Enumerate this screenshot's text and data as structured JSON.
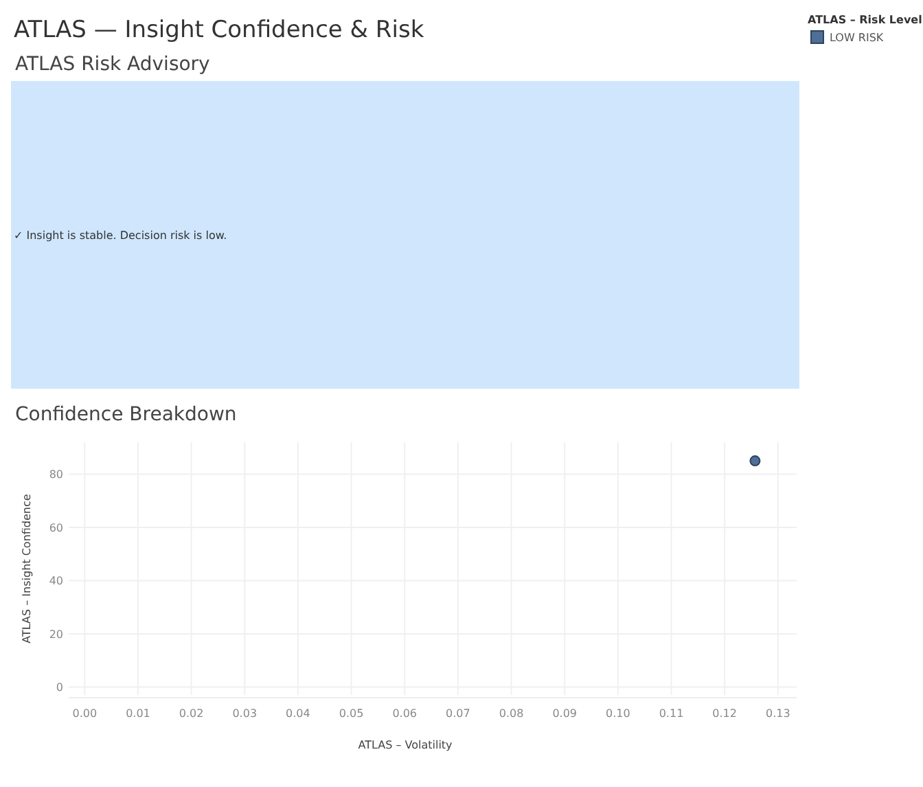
{
  "dashboard": {
    "title": "ATLAS — Insight Confidence & Risk"
  },
  "legend": {
    "title": "ATLAS – Risk Level"
  },
  "advisory": {
    "title": "ATLAS Risk Advisory",
    "message": "✓ Insight is stable. Decision risk is low."
  },
  "breakdown": {
    "title": "Confidence Breakdown",
    "chart_data": {
      "type": "scatter",
      "xlabel": "ATLAS – Volatility",
      "ylabel": "ATLAS – Insight Confidence",
      "x": [
        0.1257
      ],
      "series": [
        {
          "name": "LOW RISK",
          "color": "#4f6f97",
          "values": [
            85
          ]
        }
      ],
      "xlim": [
        -0.003,
        0.1335
      ],
      "ylim": [
        -3,
        92
      ],
      "xticks": [
        {
          "value": 0,
          "label": "0.00"
        },
        {
          "value": 0.01,
          "label": "0.01"
        },
        {
          "value": 0.02,
          "label": "0.02"
        },
        {
          "value": 0.03,
          "label": "0.03"
        },
        {
          "value": 0.04,
          "label": "0.04"
        },
        {
          "value": 0.05,
          "label": "0.05"
        },
        {
          "value": 0.06,
          "label": "0.06"
        },
        {
          "value": 0.07,
          "label": "0.07"
        },
        {
          "value": 0.08,
          "label": "0.08"
        },
        {
          "value": 0.09,
          "label": "0.09"
        },
        {
          "value": 0.1,
          "label": "0.10"
        },
        {
          "value": 0.11,
          "label": "0.11"
        },
        {
          "value": 0.12,
          "label": "0.12"
        },
        {
          "value": 0.13,
          "label": "0.13"
        }
      ],
      "yticks": [
        0,
        20,
        40,
        60,
        80
      ],
      "grid": true
    }
  }
}
